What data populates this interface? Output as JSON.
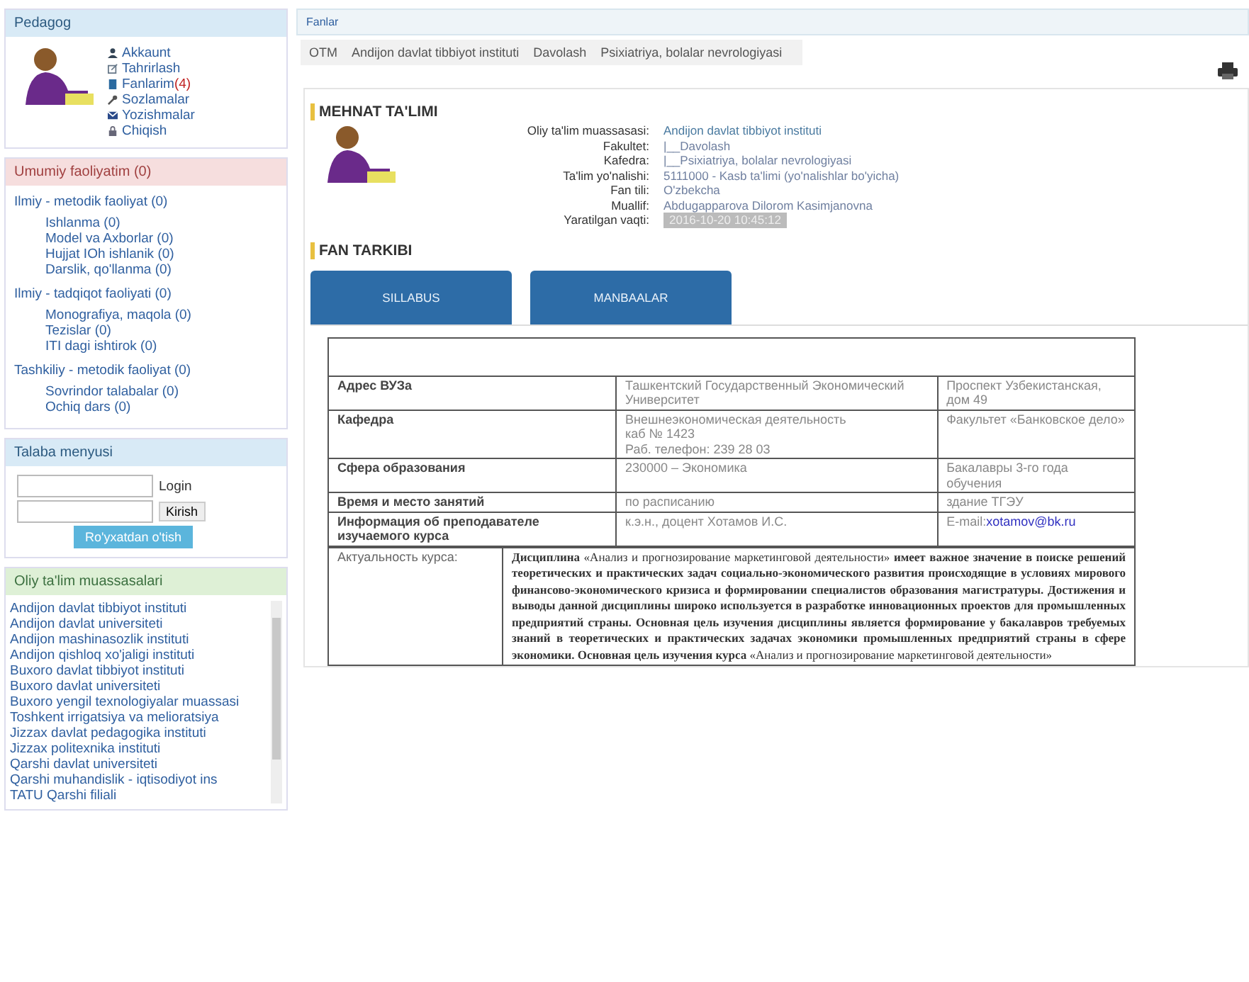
{
  "sidebar": {
    "profile": {
      "title": "Pedagog",
      "links": [
        {
          "label": "Akkaunt",
          "kind": "user"
        },
        {
          "label": "Tahrirlash",
          "kind": "edit"
        },
        {
          "label": "Fanlarim",
          "count": "(4)",
          "kind": "book"
        },
        {
          "label": "Sozlamalar",
          "kind": "wrench"
        },
        {
          "label": "Yozishmalar",
          "kind": "mail"
        },
        {
          "label": "Chiqish",
          "kind": "lock"
        }
      ]
    },
    "activity": {
      "title": "Umumiy faoliyatim (0)",
      "groups": [
        {
          "label": "Ilmiy - metodik faoliyat (0)",
          "children": [
            {
              "label": "Ishlanma (0)"
            },
            {
              "label": "Model va Axborlar (0)"
            },
            {
              "label": "Hujjat IOh ishlanik (0)"
            },
            {
              "label": "Darslik, qo'llanma (0)"
            }
          ]
        },
        {
          "label": "Ilmiy - tadqiqot faoliyati (0)",
          "children": [
            {
              "label": "Monografiya, maqola (0)"
            },
            {
              "label": "Tezislar (0)"
            },
            {
              "label": "ITI dagi ishtirok (0)"
            }
          ]
        },
        {
          "label": "Tashkiliy - metodik faoliyat (0)",
          "children": [
            {
              "label": "Sovrindor talabalar (0)"
            },
            {
              "label": "Ochiq dars (0)"
            }
          ]
        }
      ]
    },
    "student_menu": {
      "title": "Talaba menyusi",
      "login_label": "Login",
      "login_button": "Kirish",
      "register_button": "Ro'yxatdan o'tish"
    },
    "institutions": {
      "title": "Oliy ta'lim muassasalari",
      "items": [
        "Andijon davlat tibbiyot instituti",
        "Andijon davlat universiteti",
        "Andijon mashinasozlik instituti",
        "Andijon qishloq xo'jaligi instituti",
        "Buxoro davlat tibbiyot instituti",
        "Buxoro davlat universiteti",
        "Buxoro yengil texnologiyalar muassasi",
        "Toshkent irrigatsiya va melioratsiya",
        "Jizzax davlat pedagogika instituti",
        "Jizzax politexnika instituti",
        "Qarshi davlat universiteti",
        "Qarshi muhandislik - iqtisodiyot ins",
        "TATU Qarshi filiali"
      ]
    }
  },
  "main": {
    "top_tab": "Fanlar",
    "breadcrumbs": [
      "OTM",
      "Andijon davlat tibbiyot instituti",
      "Davolash",
      "Psixiatriya, bolalar nevrologiyasi"
    ],
    "course": {
      "title": "MEHNAT TA'LIMI",
      "fields": [
        {
          "label": "Oliy ta'lim muassasasi:",
          "value": "Andijon davlat tibbiyot instituti",
          "kind": "link"
        },
        {
          "label": "Fakultet:",
          "value": "|__Davolash",
          "kind": "text"
        },
        {
          "label": "Kafedra:",
          "value": "|__Psixiatriya, bolalar nevrologiyasi",
          "kind": "text"
        },
        {
          "label": "Ta'lim yo'nalishi:",
          "value": "5111000 - Kasb ta'limi (yo'nalishlar bo'yicha)",
          "kind": "text"
        },
        {
          "label": "Fan tili:",
          "value": "O'zbekcha",
          "kind": "text"
        },
        {
          "label": "Muallif:",
          "value": "Abdugapparova Dilorom Kasimjanovna",
          "kind": "text"
        },
        {
          "label": "Yaratilgan vaqti:",
          "value": "2016-10-20 10:45:12",
          "kind": "badge"
        }
      ]
    },
    "section_title": "FAN TARKIBI",
    "tabs": [
      {
        "label": "SILLABUS",
        "selected": false
      },
      {
        "label": "MANBAALAR",
        "selected": false
      }
    ],
    "document": {
      "rows": [
        {
          "cells": [
            {
              "text": "Адрес ВУЗа"
            },
            {
              "text": "Ташкентский Государственный Экономический Университет"
            },
            {
              "text": "Проспект Узбекистанская, дом 49"
            }
          ]
        },
        {
          "cells": [
            {
              "text": "Кафедра"
            },
            {
              "text": "Внешнеэкономическая деятельность\nкаб № 1423\nРаб. телефон: 239 28 03"
            },
            {
              "text": "Факультет «Банковское дело»"
            }
          ]
        },
        {
          "cells": [
            {
              "text": "Сфера образования"
            },
            {
              "text": "230000 – Экономика"
            },
            {
              "text": "Бакалавры 3-го года обучения"
            }
          ]
        },
        {
          "cells": [
            {
              "text": "Время и место занятий"
            },
            {
              "text": "по расписанию"
            },
            {
              "text": "здание ТГЭУ"
            }
          ]
        },
        {
          "cells": [
            {
              "text": "Информация об преподавателе изучаемого курса"
            },
            {
              "text": "к.э.н., доцент Хотамов И.С."
            },
            {
              "text": "E-mail:",
              "link": "xotamov@bk.ru"
            }
          ]
        }
      ],
      "relevance": {
        "label": "Актуальность курса:",
        "text": "**Дисциплина** «Анализ и прогнозирование маркетинговой деятельности» **имеет важное значение в поиске решений теоретических и практических задач социально-экономического развития происходящие в условиях мирового финансово-экономического кризиса и формировании специалистов образования магистратуры. Достижения и выводы данной дисциплины широко используется в разработке инновационных проектов для промышленных предприятий страны. Основная цель изучения дисциплины является формирование у бакалавров требуемых знаний в теоретических и практических задачах экономики промышленных предприятий страны в сфере экономики. Основная цель изучения курса** «Анализ и прогнозирование маркетинговой деятельности»"
      }
    }
  }
}
